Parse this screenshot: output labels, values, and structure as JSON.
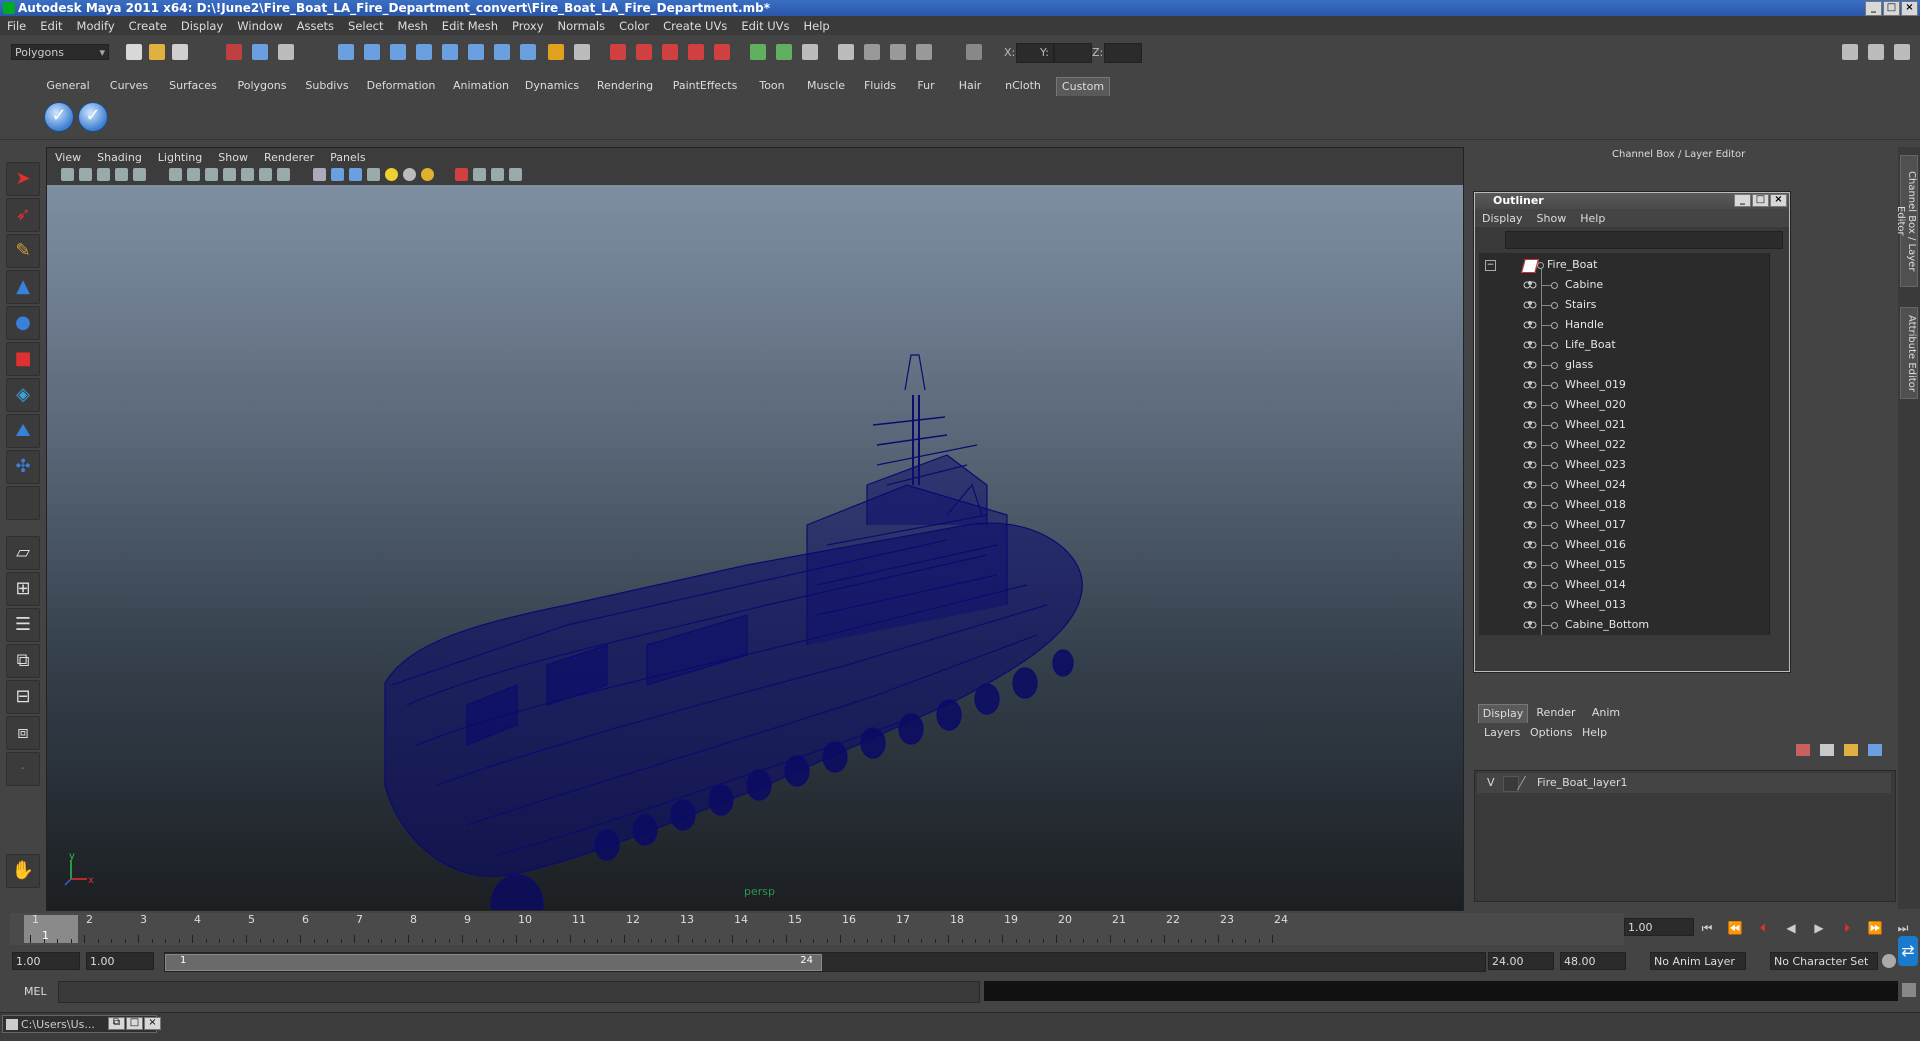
{
  "window": {
    "title": "Autodesk Maya 2011 x64: D:\\!June2\\Fire_Boat_LA_Fire_Department_convert\\Fire_Boat_LA_Fire_Department.mb*",
    "buttons": [
      "_",
      "□",
      "×"
    ]
  },
  "menubar": [
    "File",
    "Edit",
    "Modify",
    "Create",
    "Display",
    "Window",
    "Assets",
    "Select",
    "Mesh",
    "Edit Mesh",
    "Proxy",
    "Normals",
    "Color",
    "Create UVs",
    "Edit UVs",
    "Help"
  ],
  "statusline": {
    "mode_select": "Polygons",
    "x_label": "X:",
    "y_label": "Y:",
    "z_label": "Z:"
  },
  "shelf": {
    "tabs": [
      "General",
      "Curves",
      "Surfaces",
      "Polygons",
      "Subdivs",
      "Deformation",
      "Animation",
      "Dynamics",
      "Rendering",
      "PaintEffects",
      "Toon",
      "Muscle",
      "Fluids",
      "Fur",
      "Hair",
      "nCloth",
      "Custom"
    ],
    "active_tab": "Custom"
  },
  "viewport": {
    "menu": [
      "View",
      "Shading",
      "Lighting",
      "Show",
      "Renderer",
      "Panels"
    ],
    "camera_label": "persp",
    "axis_y": "y",
    "axis_x": "x",
    "wireframe_color": "#0a0a6e"
  },
  "channel_box": {
    "title": "Channel Box / Layer Editor",
    "side_tabs": [
      "Channel Box / Layer Editor",
      "Attribute Editor"
    ]
  },
  "outliner": {
    "title": "Outliner",
    "menu": [
      "Display",
      "Show",
      "Help"
    ],
    "root": "Fire_Boat",
    "items": [
      "Cabine",
      "Stairs",
      "Handle",
      "Life_Boat",
      "glass",
      "Wheel_019",
      "Wheel_020",
      "Wheel_021",
      "Wheel_022",
      "Wheel_023",
      "Wheel_024",
      "Wheel_018",
      "Wheel_017",
      "Wheel_016",
      "Wheel_015",
      "Wheel_014",
      "Wheel_013",
      "Cabine_Bottom"
    ]
  },
  "layer_editor": {
    "tabs": [
      "Display",
      "Render",
      "Anim"
    ],
    "active_tab": "Display",
    "menu": [
      "Layers",
      "Options",
      "Help"
    ],
    "layers": [
      {
        "visible": "V",
        "name": "Fire_Boat_layer1"
      }
    ]
  },
  "timeline": {
    "ticks": [
      "1",
      "2",
      "3",
      "4",
      "5",
      "6",
      "7",
      "8",
      "9",
      "10",
      "11",
      "12",
      "13",
      "14",
      "15",
      "16",
      "17",
      "18",
      "19",
      "20",
      "21",
      "22",
      "23",
      "24"
    ],
    "current_frame_marker": "1",
    "current_time": "1.00"
  },
  "range": {
    "start_time": "1.00",
    "playback_start": "1.00",
    "handle_start": "1",
    "handle_end": "24",
    "playback_end": "24.00",
    "end_time": "48.00",
    "anim_layer": "No Anim Layer",
    "character_set": "No Character Set"
  },
  "command": {
    "label": "MEL"
  },
  "taskbar": {
    "item": "C:\\Users\\Us..."
  }
}
